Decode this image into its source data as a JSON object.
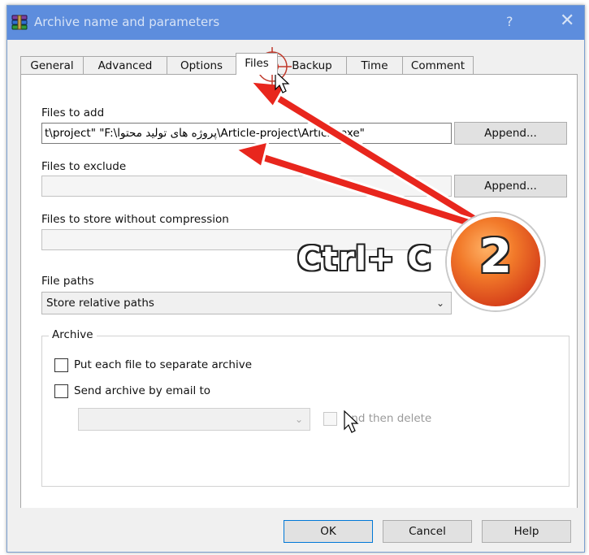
{
  "window": {
    "title": "Archive name and parameters",
    "help_glyph": "?",
    "close_glyph": "✕"
  },
  "tabs": [
    {
      "label": "General"
    },
    {
      "label": "Advanced"
    },
    {
      "label": "Options"
    },
    {
      "label": "Files",
      "active": true
    },
    {
      "label": "Backup"
    },
    {
      "label": "Time"
    },
    {
      "label": "Comment"
    }
  ],
  "files_to_add": {
    "label": "Files to add",
    "value": "t\\project\" \"F:\\پروژه های تولید محتوا\\Article-project\\Article.exe\"",
    "append_label": "Append..."
  },
  "files_to_exclude": {
    "label": "Files to exclude",
    "value": "",
    "append_label": "Append..."
  },
  "files_no_compress": {
    "label": "Files to store without compression",
    "value": ""
  },
  "file_paths": {
    "label": "File paths",
    "selected": "Store relative paths"
  },
  "archive_group": {
    "legend": "Archive",
    "separate_label": "Put each file to separate archive",
    "separate_checked": false,
    "email_label": "Send archive by email to",
    "email_checked": false,
    "email_value": "",
    "delete_label": "and then delete",
    "delete_checked": false
  },
  "footer": {
    "ok_label": "OK",
    "cancel_label": "Cancel",
    "help_label": "Help"
  },
  "annotation": {
    "shortcut_text": "Ctrl+ C",
    "step_number": "2",
    "arrow_color": "#e8261d",
    "badge_color": "#e2571f"
  }
}
